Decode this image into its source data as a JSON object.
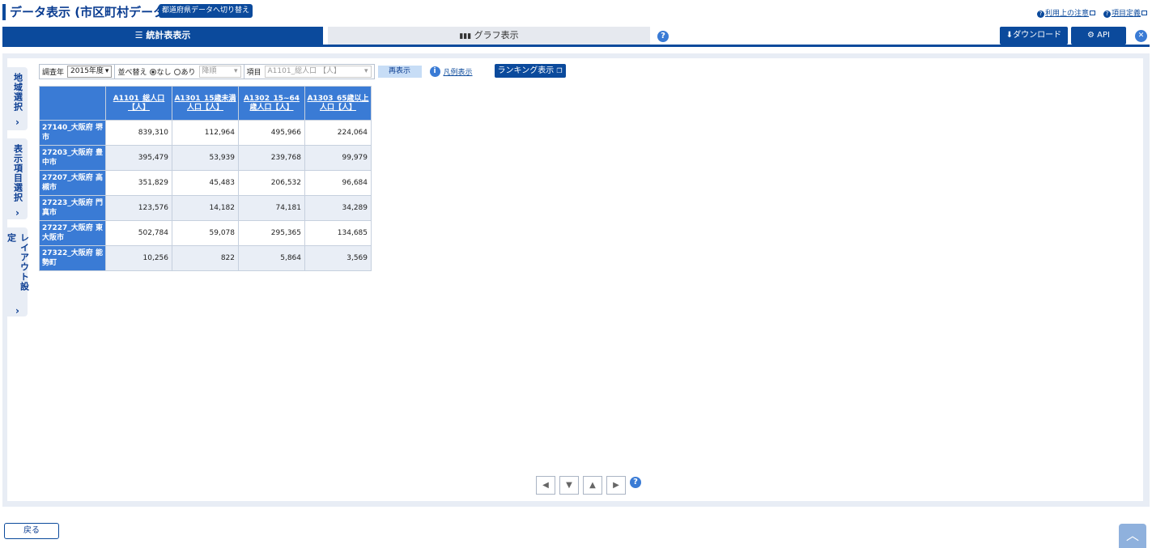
{
  "header": {
    "title": "データ表示 (市区町村データ)",
    "switch_label": "都道府県データへ切り替え",
    "link_notes": "利用上の注意",
    "link_definitions": "項目定義"
  },
  "tabs": {
    "stats": "統計表表示",
    "graph": "グラフ表示",
    "download": "ダウンロード",
    "api": "API"
  },
  "sidebar": {
    "region": "地域選択",
    "items": "表示項目選択",
    "layout": "レイアウト設定"
  },
  "controls": {
    "year_label": "調査年",
    "year_value": "2015年度",
    "sort_label": "並べ替え",
    "sort_none": "なし",
    "sort_yes": "あり",
    "order_value": "降順",
    "item_label": "項目",
    "item_value": "A1101_総人口 【人】",
    "redisplay": "再表示",
    "legend": "凡例表示",
    "ranking": "ランキング表示"
  },
  "table": {
    "columns": [
      "A1101_総人口【人】",
      "A1301_15歳未満人口【人】",
      "A1302_15~64歳人口【人】",
      "A1303_65歳以上人口【人】"
    ],
    "rows": [
      {
        "region": "27140_大阪府 堺市",
        "values": [
          "839,310",
          "112,964",
          "495,966",
          "224,064"
        ]
      },
      {
        "region": "27203_大阪府 豊中市",
        "values": [
          "395,479",
          "53,939",
          "239,768",
          "99,979"
        ]
      },
      {
        "region": "27207_大阪府 高槻市",
        "values": [
          "351,829",
          "45,483",
          "206,532",
          "96,684"
        ]
      },
      {
        "region": "27223_大阪府 門真市",
        "values": [
          "123,576",
          "14,182",
          "74,181",
          "34,289"
        ]
      },
      {
        "region": "27227_大阪府 東大阪市",
        "values": [
          "502,784",
          "59,078",
          "295,365",
          "134,685"
        ]
      },
      {
        "region": "27322_大阪府 能勢町",
        "values": [
          "10,256",
          "822",
          "5,864",
          "3,569"
        ]
      }
    ]
  },
  "footer": {
    "back": "戻る"
  }
}
